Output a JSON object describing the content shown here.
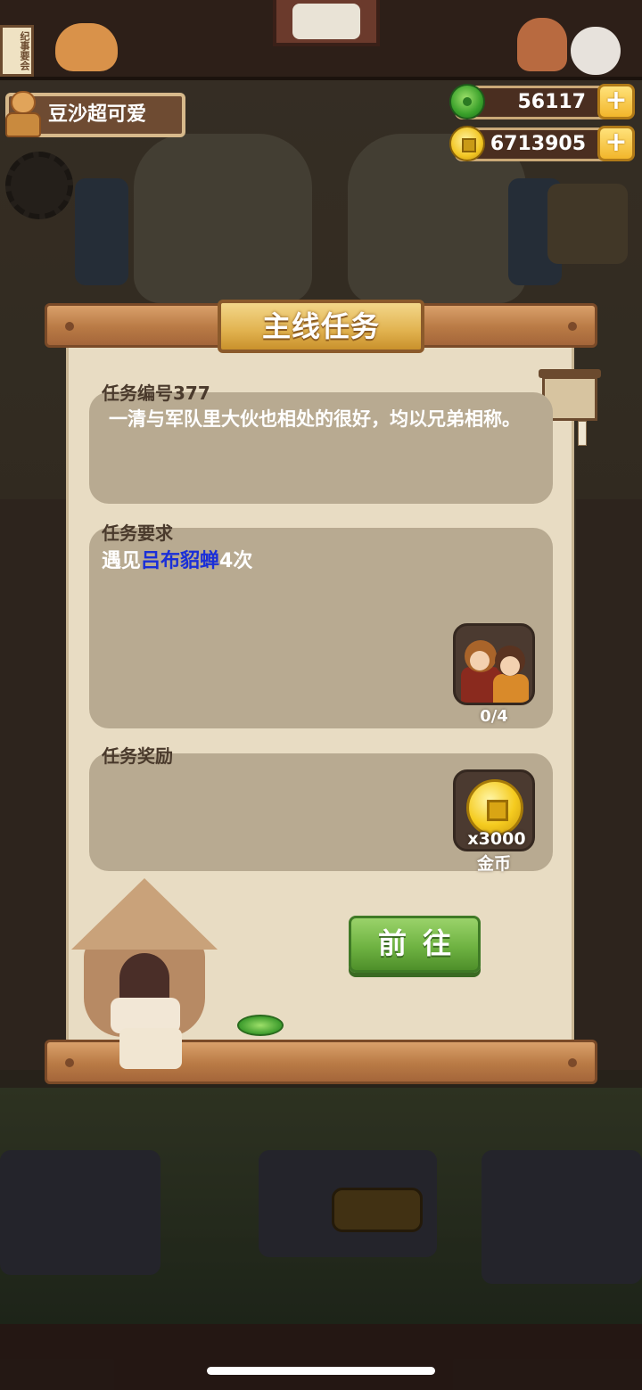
{
  "hud": {
    "sign_text": "纪事要会",
    "player_name": "豆沙超可爱",
    "jade_amount": "56117",
    "gold_amount": "6713905",
    "plus_label": "+"
  },
  "quest": {
    "title": "主线任务",
    "id_label": "任务编号377",
    "description": "一清与军队里大伙也相处的很好，均以兄弟相称。",
    "requirement_label": "任务要求",
    "requirement_prefix": "遇见",
    "requirement_target": "吕布貂蝉",
    "requirement_suffix": "4次",
    "progress": "0/4",
    "reward_label": "任务奖励",
    "reward_qty": "x3000",
    "reward_name": "金币",
    "go_button": "前往"
  },
  "colors": {
    "highlight": "#1a2fd8",
    "go_button": "#6fb342",
    "title_plaque": "#e1b24f"
  }
}
